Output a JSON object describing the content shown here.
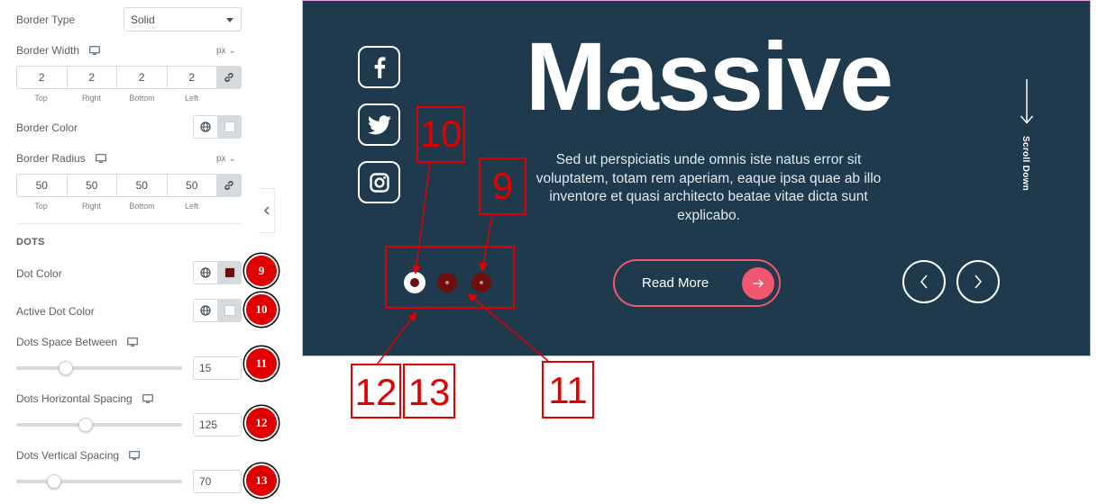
{
  "panel": {
    "border_type": {
      "label": "Border Type",
      "value": "Solid"
    },
    "border_width": {
      "label": "Border Width",
      "unit": "px",
      "values": [
        "2",
        "2",
        "2",
        "2"
      ],
      "sides": [
        "Top",
        "Right",
        "Bottom",
        "Left"
      ]
    },
    "border_color": {
      "label": "Border Color"
    },
    "border_radius": {
      "label": "Border Radius",
      "unit": "px",
      "values": [
        "50",
        "50",
        "50",
        "50"
      ],
      "sides": [
        "Top",
        "Right",
        "Bottom",
        "Left"
      ]
    },
    "dots_section": "DOTS",
    "dot_color": {
      "label": "Dot Color",
      "swatch": "#6b0f0f",
      "badge": "9"
    },
    "active_dot_color": {
      "label": "Active Dot Color",
      "swatch": "#ffffff",
      "badge": "10"
    },
    "dots_space_between": {
      "label": "Dots Space Between",
      "value": "15",
      "level": 0.3,
      "badge": "11"
    },
    "dots_horizontal_spacing": {
      "label": "Dots Horizontal Spacing",
      "value": "125",
      "level": 0.42,
      "badge": "12"
    },
    "dots_vertical_spacing": {
      "label": "Dots Vertical Spacing",
      "value": "70",
      "level": 0.23,
      "badge": "13"
    }
  },
  "preview": {
    "social_icons": [
      "facebook-icon",
      "twitter-icon",
      "instagram-icon"
    ],
    "title": "Massive",
    "description": "Sed ut perspiciatis unde omnis iste natus error sit voluptatem, totam rem aperiam, eaque ipsa quae ab illo inventore et quasi architecto beatae vitae dicta sunt explicabo.",
    "read_more": "Read More",
    "scroll_down": "Scroll Down",
    "background": "#1e3a4c",
    "accent": "#f25670"
  },
  "annotations": {
    "active_dot": "10",
    "dot": "9",
    "space_between": "11",
    "horizontal": "12",
    "vertical": "13"
  }
}
